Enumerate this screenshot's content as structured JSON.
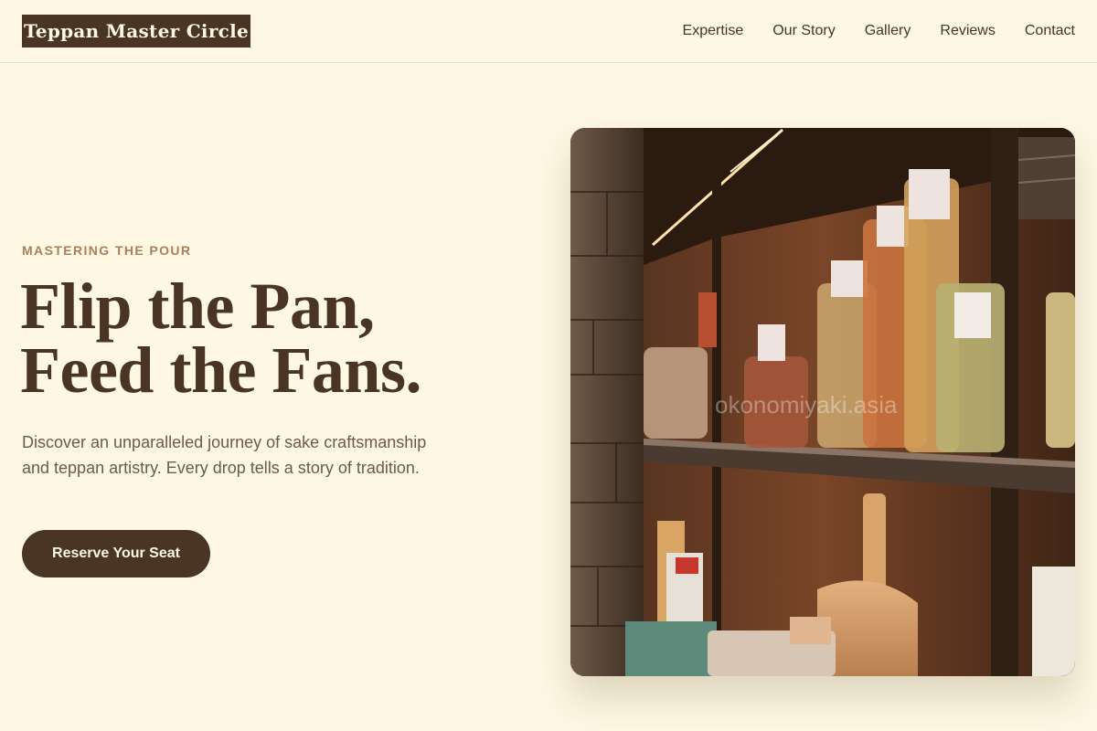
{
  "header": {
    "brand": "Teppan Master Circle",
    "nav": [
      {
        "label": "Expertise"
      },
      {
        "label": "Our Story"
      },
      {
        "label": "Gallery"
      },
      {
        "label": "Reviews"
      },
      {
        "label": "Contact"
      }
    ]
  },
  "hero": {
    "eyebrow": "MASTERING THE POUR",
    "headline_line1": "Flip the Pan,",
    "headline_line2": "Feed the Fans.",
    "description": "Discover an unparalleled journey of sake craftsmanship and teppan artistry. Every drop tells a story of tradition.",
    "cta_label": "Reserve Your Seat",
    "image_watermark": "okonomiyaki.asia"
  },
  "colors": {
    "background": "#fdf7e3",
    "primary": "#4a3424",
    "accent": "#a9805c"
  }
}
